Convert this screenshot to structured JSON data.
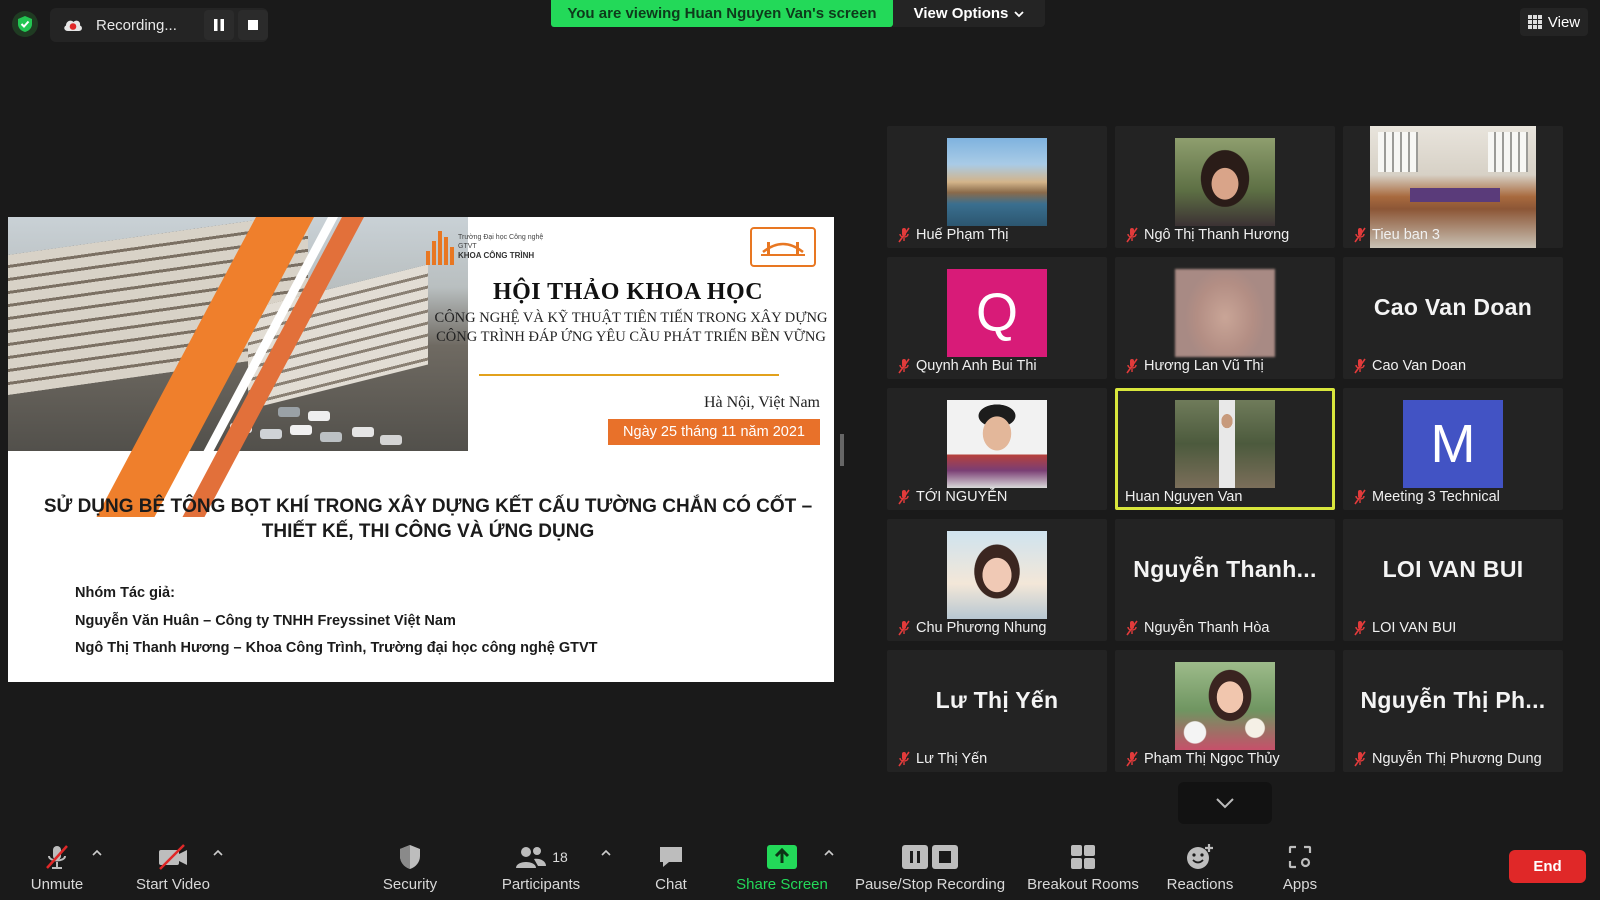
{
  "topbar": {
    "recording_label": "Recording...",
    "viewing_banner": "You are viewing Huan Nguyen Van's screen",
    "view_options_label": "View Options",
    "view_label": "View"
  },
  "slide": {
    "logo_left_line1": "Trường Đại học Công nghệ GTVT",
    "logo_left_line2": "KHOA CÔNG TRÌNH",
    "conference_title": "HỘI THẢO KHOA HỌC",
    "conference_subtitle": "CÔNG NGHỆ VÀ KỸ THUẬT TIÊN TIẾN TRONG XÂY DỰNG CÔNG TRÌNH ĐÁP ỨNG YÊU CẦU PHÁT TRIỂN BỀN VỮNG",
    "place": "Hà Nội, Việt Nam",
    "date": "Ngày 25 tháng 11 năm 2021",
    "paper_title": "SỬ DỤNG BÊ TÔNG BỌT KHÍ TRONG XÂY DỰNG KẾT CẤU TƯỜNG CHẮN CÓ CỐT – THIẾT KẾ, THI CÔNG VÀ ỨNG DỤNG",
    "authors_heading": "Nhóm Tác giả:",
    "author_1": "Nguyễn Văn Huân – Công ty TNHH Freyssinet Việt Nam",
    "author_2": "Ngô Thị Thanh Hương – Khoa Công Trình, Trường đại học công nghệ GTVT"
  },
  "participants": [
    {
      "name": "Huế Phạm Thị",
      "display": "photo-lake"
    },
    {
      "name": "Ngô Thị Thanh Hương",
      "display": "photo-woman"
    },
    {
      "name": "Tieu ban 3",
      "display": "photo-room"
    },
    {
      "name": "Quynh Anh Bui Thi",
      "display": "letter",
      "letter": "Q",
      "color": "#d81b78"
    },
    {
      "name": "Hương Lan Vũ Thị",
      "display": "photo-blur"
    },
    {
      "name": "Cao Van Doan",
      "display": "text",
      "big_name": "Cao Van Doan"
    },
    {
      "name": "TỚI NGUYỄN",
      "display": "photo-man"
    },
    {
      "name": "Huan Nguyen Van",
      "display": "photo-outdoor",
      "active": true
    },
    {
      "name": "Meeting 3 Technical",
      "display": "letter",
      "letter": "M",
      "color": "#4253c4"
    },
    {
      "name": "Chu Phương Nhung",
      "display": "photo-girl"
    },
    {
      "name": "Nguyễn Thanh Hòa",
      "display": "text",
      "big_name": "Nguyễn  Thanh..."
    },
    {
      "name": "LOI VAN BUI",
      "display": "text",
      "big_name": "LOI VAN BUI"
    },
    {
      "name": "Lư Thị Yến",
      "display": "text",
      "big_name": "Lư Thị Yến"
    },
    {
      "name": "Phạm Thị Ngọc Thủy",
      "display": "photo-flowers"
    },
    {
      "name": "Nguyễn Thị Phương Dung",
      "display": "text",
      "big_name": "Nguyễn  Thị  Ph..."
    }
  ],
  "toolbar": {
    "unmute": "Unmute",
    "start_video": "Start Video",
    "security": "Security",
    "participants": "Participants",
    "participants_count": "18",
    "chat": "Chat",
    "share_screen": "Share Screen",
    "pause_stop_recording": "Pause/Stop Recording",
    "breakout_rooms": "Breakout Rooms",
    "reactions": "Reactions",
    "apps": "Apps",
    "end": "End"
  },
  "colors": {
    "banner_green": "#23d959",
    "share_green": "#23d959",
    "end_red": "#e02828",
    "active_speaker": "#d8e63c",
    "slide_orange": "#e8712a"
  }
}
